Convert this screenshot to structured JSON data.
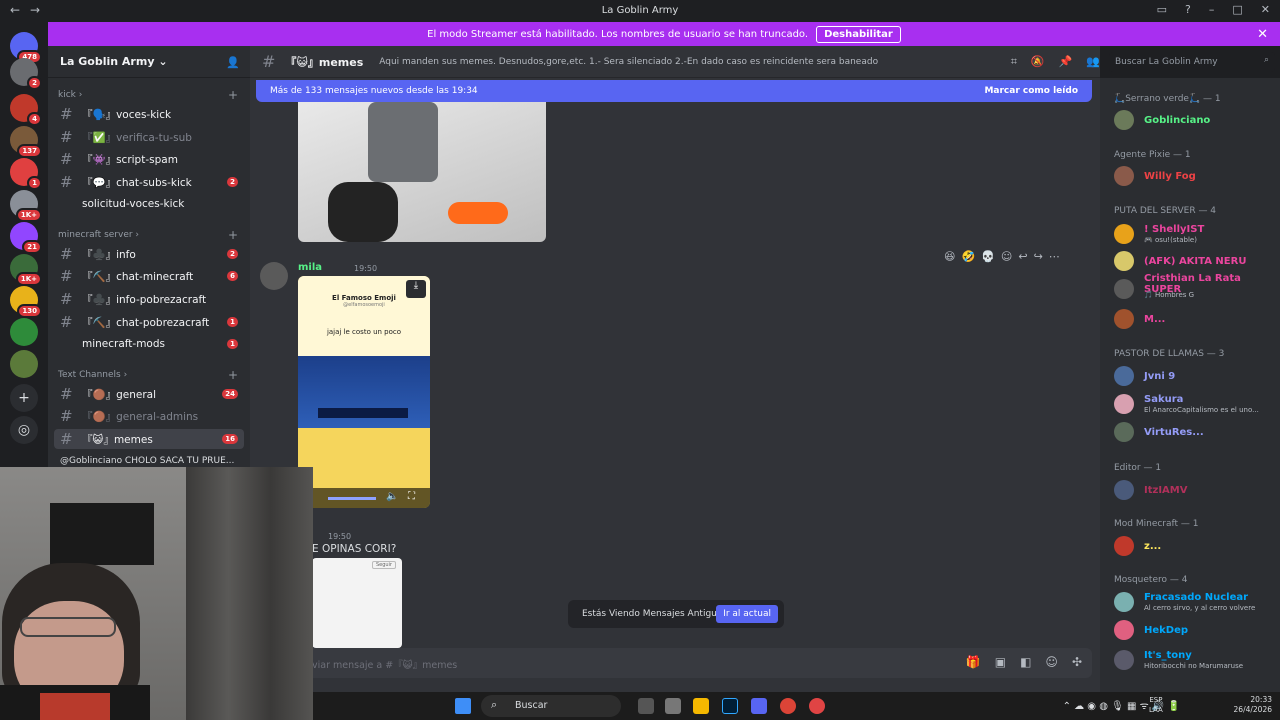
{
  "window": {
    "title": "La Goblin Army"
  },
  "banner": {
    "text": "El modo Streamer está habilitado. Los nombres de usuario se han truncado.",
    "button": "Deshabilitar"
  },
  "guilds": [
    {
      "badge": "478",
      "color": "#5865f2"
    },
    {
      "badge": "2",
      "color": "#6a6c70"
    },
    {
      "badge": "4",
      "color": "#c0392b"
    },
    {
      "badge": "137",
      "color": "#7a5a3a"
    },
    {
      "badge": "1",
      "color": "#e04040"
    },
    {
      "badge": "1K+",
      "color": "#8a8f98"
    },
    {
      "badge": "21",
      "color": "#9146ff"
    },
    {
      "badge": "1K+",
      "color": "#3a6b3a"
    },
    {
      "badge": "130",
      "color": "#e8b21a"
    },
    {
      "badge": "",
      "color": "#2e8b3a"
    },
    {
      "badge": "",
      "color": "#5b7a3a"
    }
  ],
  "sidebar": {
    "server_name": "La Goblin Army",
    "categories": [
      {
        "name": "kick"
      },
      {
        "name": "minecraft server"
      },
      {
        "name": "Text Channels"
      }
    ],
    "channels": [
      {
        "label": "『🗣️』voces-kick",
        "muted": false,
        "badge": ""
      },
      {
        "label": "『✅』verifica-tu-sub",
        "muted": true,
        "badge": ""
      },
      {
        "label": "『👾』script-spam",
        "muted": false,
        "badge": ""
      },
      {
        "label": "『💬』chat-subs-kick",
        "muted": false,
        "badge": "2"
      },
      {
        "label": "solicitud-voces-kick",
        "muted": false,
        "badge": ""
      },
      {
        "label": "『♣️』info",
        "muted": false,
        "badge": "2"
      },
      {
        "label": "『⛏️』chat-minecraft",
        "muted": false,
        "badge": "6"
      },
      {
        "label": "『♣️』info-pobrezacraft",
        "muted": false,
        "badge": ""
      },
      {
        "label": "『⛏️』chat-pobrezacraft",
        "muted": false,
        "badge": "1"
      },
      {
        "label": "minecraft-mods",
        "muted": false,
        "badge": "1"
      },
      {
        "label": "『🟤』general",
        "muted": false,
        "badge": "24"
      },
      {
        "label": "『🟤』general-admins",
        "muted": true,
        "badge": ""
      },
      {
        "label": "『😺』memes",
        "muted": false,
        "badge": "16"
      }
    ],
    "thread": "@Goblinciano CHOLO SACA TU PRUE..."
  },
  "header": {
    "channel": "『😺』memes",
    "topic": "Aqui manden sus memes. Desnudos,gore,etc. 1.- Sera silenciado 2.-En dado caso es reincidente sera baneado",
    "search_placeholder": "Buscar La Goblin Army"
  },
  "main": {
    "newbar": {
      "text": "Más de 133 mensajes nuevos desde las 19:34",
      "action": "Marcar como leído"
    },
    "message1": {
      "author": "mila",
      "time": "19:50"
    },
    "card": {
      "title": "El Famoso Emoji",
      "handle": "@elfamosoemoji",
      "caption": "jajaj le costo un poco"
    },
    "message2": {
      "time": "19:50",
      "text": "E OPINAS CORI?",
      "button": "Seguir"
    },
    "toast": {
      "text": "Estás Viendo Mensajes Antiguos",
      "button": "Ir al actual"
    },
    "composer": {
      "placeholder": "viar mensaje a #『😺』memes"
    }
  },
  "members": {
    "roles": [
      {
        "label": "🛴Serrano verde🛴 — 1"
      },
      {
        "label": "Agente Pixie — 1"
      },
      {
        "label": "PUTA DEL SERVER — 4"
      },
      {
        "label": "PASTOR DE LLAMAS — 3"
      },
      {
        "label": "Editor — 1"
      },
      {
        "label": "Mod Minecraft — 1"
      },
      {
        "label": "Mosquetero — 4"
      }
    ],
    "list": [
      {
        "name": "Goblinciano",
        "status": "",
        "color": "#57f287",
        "av": "#6b7a5a"
      },
      {
        "name": "Willy Fog",
        "status": "",
        "color": "#ed4245",
        "av": "#8a5a4a"
      },
      {
        "name": "! ShellyIST",
        "status": "🎮 osu!(stable)",
        "color": "#eb459e",
        "av": "#e8a21a"
      },
      {
        "name": "(AFK) AKITA NERU",
        "status": "",
        "color": "#eb459e",
        "av": "#d8c86a"
      },
      {
        "name": "Cristhian La Rata SUPER",
        "status": "🎵 Hombres G",
        "color": "#eb459e",
        "av": "#5a5a5a"
      },
      {
        "name": "M...",
        "status": "",
        "color": "#eb459e",
        "av": "#a0522d"
      },
      {
        "name": "Jvni 9",
        "status": "",
        "color": "#949cf7",
        "av": "#4a6a9a"
      },
      {
        "name": "Sakura",
        "status": "El AnarcoCapitalismo es el uno...",
        "color": "#949cf7",
        "av": "#d8a0b0"
      },
      {
        "name": "VirtuRes...",
        "status": "",
        "color": "#949cf7",
        "av": "#5a6a5a"
      },
      {
        "name": "ItzIAMV",
        "status": "",
        "color": "#b1305a",
        "av": "#4a5a7a"
      },
      {
        "name": "z...",
        "status": "",
        "color": "#fee75c",
        "av": "#c0392b"
      },
      {
        "name": "Fracasado Nuclear",
        "status": "Al cerro sirvo, y al cerro volvere",
        "color": "#00a8fc",
        "av": "#7ab0b0"
      },
      {
        "name": "HekDep",
        "status": "",
        "color": "#00a8fc",
        "av": "#e06080"
      },
      {
        "name": "It's_tony",
        "status": "Hitoribocchi no Marumaruse",
        "color": "#00a8fc",
        "av": "#5a5a6a"
      }
    ]
  },
  "taskbar": {
    "search": "Buscar",
    "lang1": "ESP",
    "lang2": "LAA",
    "time": "20:33",
    "date": "26/4/2026"
  }
}
